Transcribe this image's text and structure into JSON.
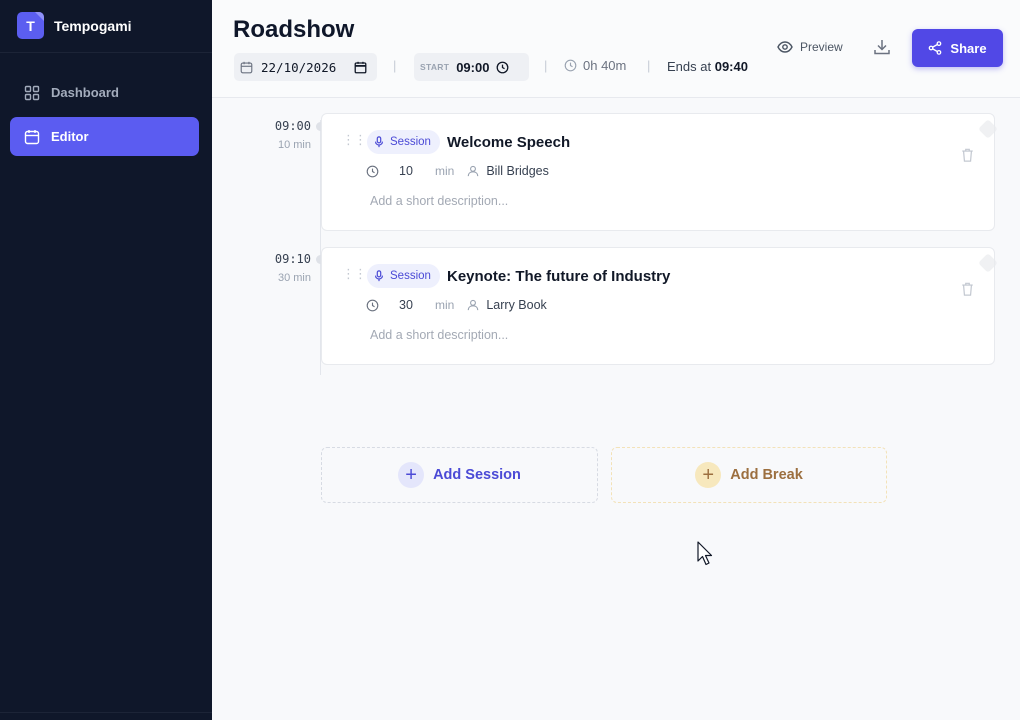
{
  "app": {
    "name": "Tempogami",
    "logo_letter": "T",
    "accent": "#5b5cf1"
  },
  "sidebar": {
    "items": [
      {
        "label": "Dashboard",
        "icon": "grid-icon",
        "active": false
      },
      {
        "label": "Editor",
        "icon": "calendar-icon",
        "active": true
      }
    ]
  },
  "header": {
    "title": "Roadshow",
    "date": "22/10/2026",
    "start_label": "START",
    "start_time": "09:00",
    "duration": "0h 40m",
    "ends_prefix": "Ends at",
    "ends_time": "09:40",
    "separator": "|",
    "preview_label": "Preview",
    "share_label": "Share"
  },
  "agenda": [
    {
      "time": "09:00",
      "length": "10 min",
      "type": "Session",
      "title": "Welcome Speech",
      "duration": "10",
      "unit": "min",
      "speaker": "Bill Bridges",
      "description_placeholder": "Add a short description..."
    },
    {
      "time": "09:10",
      "length": "30 min",
      "type": "Session",
      "title": "Keynote: The future of Industry",
      "duration": "30",
      "unit": "min",
      "speaker": "Larry Book",
      "description_placeholder": "Add a short description..."
    }
  ],
  "actions": {
    "add_session": "Add Session",
    "add_break": "Add Break",
    "plus": "+"
  }
}
